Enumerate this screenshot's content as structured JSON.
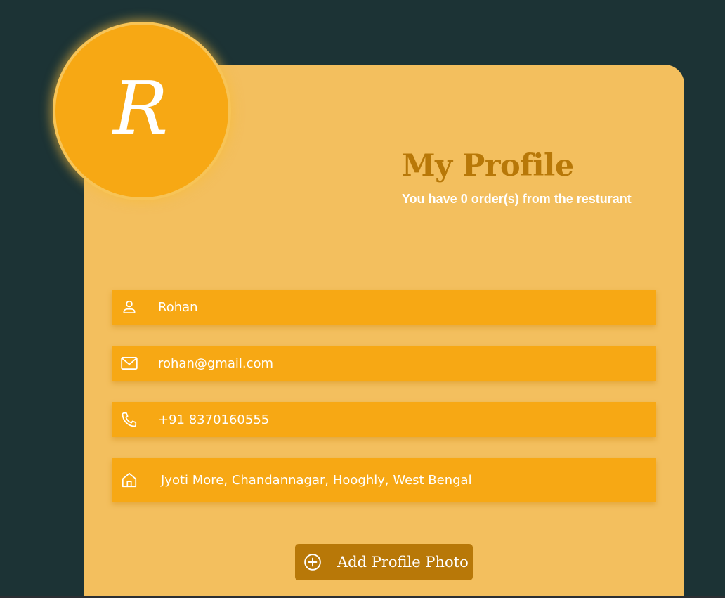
{
  "profile": {
    "avatar_letter": "R",
    "title": "My Profile",
    "subtitle": "You have 0 order(s) from the resturant"
  },
  "fields": {
    "name": {
      "icon": "person-icon",
      "value": "Rohan"
    },
    "email": {
      "icon": "mail-icon",
      "value": "rohan@gmail.com"
    },
    "phone": {
      "icon": "phone-icon",
      "value": "+91 8370160555"
    },
    "address": {
      "icon": "home-icon",
      "value": "Jyoti More, Chandannagar, Hooghly, West Bengal"
    }
  },
  "actions": {
    "add_photo_label": "Add Profile Photo",
    "add_photo_icon": "plus-circle-icon"
  },
  "colors": {
    "background": "#1c3335",
    "card": "#f3bf5e",
    "accent": "#f7a814",
    "title": "#b87808",
    "button": "#b87808"
  }
}
